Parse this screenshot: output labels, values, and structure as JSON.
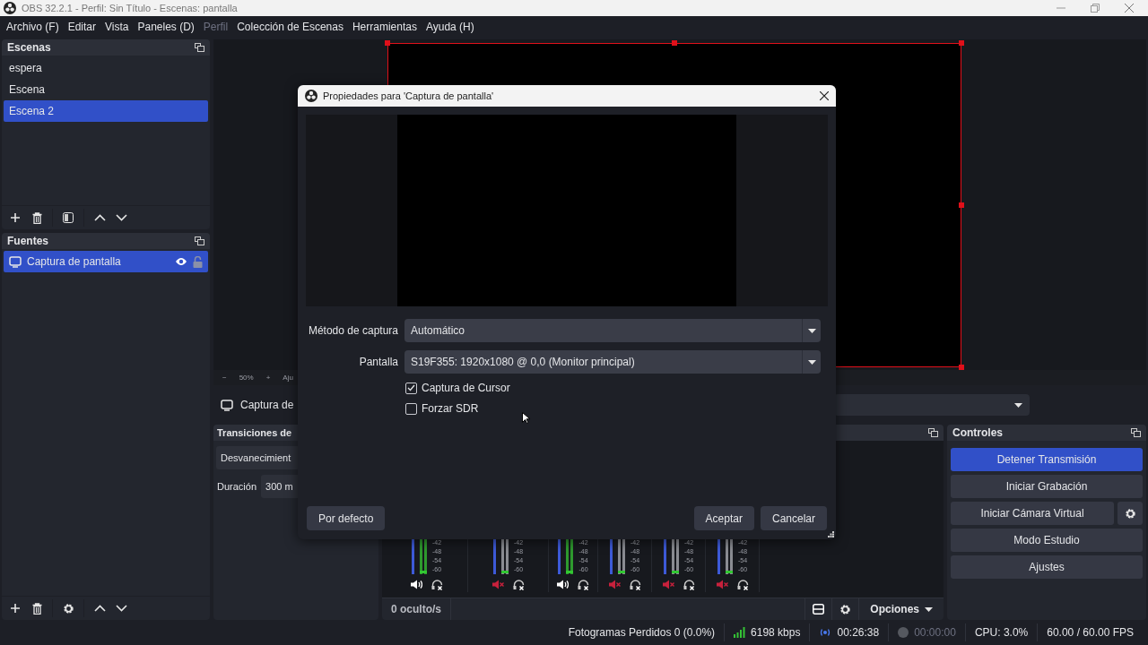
{
  "window": {
    "title": "OBS 32.2.1 - Perfil: Sin Título - Escenas: pantalla"
  },
  "menu": [
    {
      "label": "Archivo (F)",
      "disabled": false
    },
    {
      "label": "Editar",
      "disabled": false
    },
    {
      "label": "Vista",
      "disabled": false
    },
    {
      "label": "Paneles (D)",
      "disabled": false
    },
    {
      "label": "Perfil",
      "disabled": true
    },
    {
      "label": "Colección de Escenas",
      "disabled": false
    },
    {
      "label": "Herramientas",
      "disabled": false
    },
    {
      "label": "Ayuda (H)",
      "disabled": false
    }
  ],
  "scenes": {
    "title": "Escenas",
    "items": [
      {
        "label": "espera",
        "selected": false
      },
      {
        "label": "Escena",
        "selected": false
      },
      {
        "label": "Escena 2",
        "selected": true
      }
    ]
  },
  "sources": {
    "title": "Fuentes",
    "items": [
      {
        "label": "Captura de pantalla",
        "selected": true,
        "visible": true,
        "locked": false
      }
    ]
  },
  "preview": {
    "zoom_out": "−",
    "zoom": "50%",
    "zoom_in": "+",
    "fit": "Aju"
  },
  "source_toolbar": {
    "source": "Captura de"
  },
  "transitions": {
    "title": "Transiciones de",
    "transition": "Desvanecimient",
    "duration_label": "Duración",
    "duration": "300 m"
  },
  "mixer": {
    "channels": [
      {
        "muted": false,
        "scale": [
          "-42",
          "-48",
          "-54",
          "-60"
        ]
      },
      {
        "muted": true,
        "scale": [
          "-42",
          "-48",
          "-54",
          "-60"
        ]
      },
      {
        "muted": false,
        "scale": [
          "-42",
          "-48",
          "-54",
          "-60"
        ]
      },
      {
        "muted": true,
        "scale": [
          "-42",
          "-48",
          "-54",
          "-60"
        ]
      },
      {
        "muted": true,
        "scale": [
          "-42",
          "-48",
          "-54",
          "-60"
        ]
      },
      {
        "muted": true,
        "scale": [
          "-42",
          "-48",
          "-54",
          "-60"
        ]
      }
    ],
    "hidden_count": "0 oculto/s",
    "options": "Opciones"
  },
  "controls": {
    "title": "Controles",
    "buttons": [
      {
        "label": "Detener Transmisión",
        "highlighted": true,
        "kind": "plain"
      },
      {
        "label": "Iniciar Grabación",
        "highlighted": false,
        "kind": "plain"
      },
      {
        "label": "Iniciar Cámara Virtual",
        "highlighted": false,
        "kind": "settings"
      },
      {
        "label": "Modo Estudio",
        "highlighted": false,
        "kind": "plain"
      },
      {
        "label": "Ajustes",
        "highlighted": false,
        "kind": "plain"
      }
    ]
  },
  "status_bar": {
    "dropped_frames": "Fotogramas Perdidos 0 (0.0%)",
    "bitrate": "6198 kbps",
    "stream_time": "00:26:38",
    "recording": false,
    "record_time": "00:00:00",
    "cpu": "CPU: 3.0%",
    "fps": "60.00 / 60.00 FPS"
  },
  "dialog": {
    "title": "Propiedades para 'Captura de pantalla'",
    "fields": [
      {
        "label": "Método de captura",
        "value": "Automático"
      },
      {
        "label": "Pantalla",
        "value": "S19F355: 1920x1080 @ 0,0 (Monitor principal)"
      }
    ],
    "checkboxes": [
      {
        "label": "Captura de Cursor",
        "checked": true
      },
      {
        "label": "Forzar SDR",
        "checked": false
      }
    ],
    "defaults_button": "Por defecto",
    "ok_button": "Aceptar",
    "cancel_button": "Cancelar"
  }
}
